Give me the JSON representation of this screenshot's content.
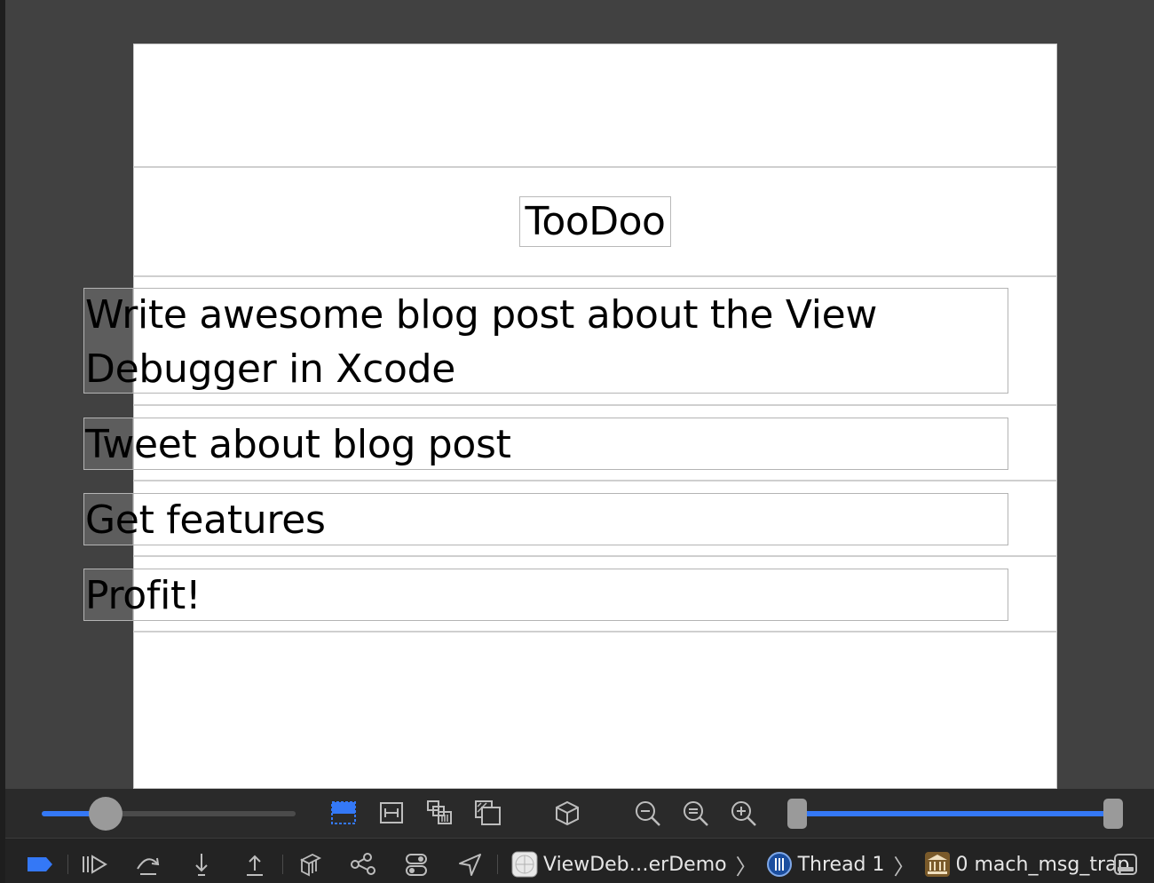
{
  "app": {
    "title": "TooDoo",
    "items": [
      {
        "label": "Write awesome blog post about the View\nDebugger in Xcode"
      },
      {
        "label": "Tweet about blog post"
      },
      {
        "label": "Get features"
      },
      {
        "label": "Profit!"
      }
    ]
  },
  "debug_bar": {
    "spacing_slider_value": 0.25,
    "range_slider": {
      "low": 0.0,
      "high": 1.0
    },
    "accent_color": "#3478f6",
    "layout_tools": [
      "show-clipped-icon",
      "show-constraints-icon",
      "adjust-view-mode-icon",
      "change-canvas-bg-icon",
      "orient-3d-icon",
      "zoom-out-icon",
      "zoom-actual-icon",
      "zoom-in-icon"
    ],
    "debug_tools": [
      "breakpoints-icon",
      "continue-icon",
      "step-over-icon",
      "step-into-icon",
      "step-out-icon",
      "view-debugger-icon",
      "memory-graph-icon",
      "environment-icon",
      "location-icon"
    ]
  },
  "breadcrumb": {
    "app_name": "ViewDeb…erDemo",
    "thread": "Thread 1",
    "frame": "0 mach_msg_trap"
  }
}
